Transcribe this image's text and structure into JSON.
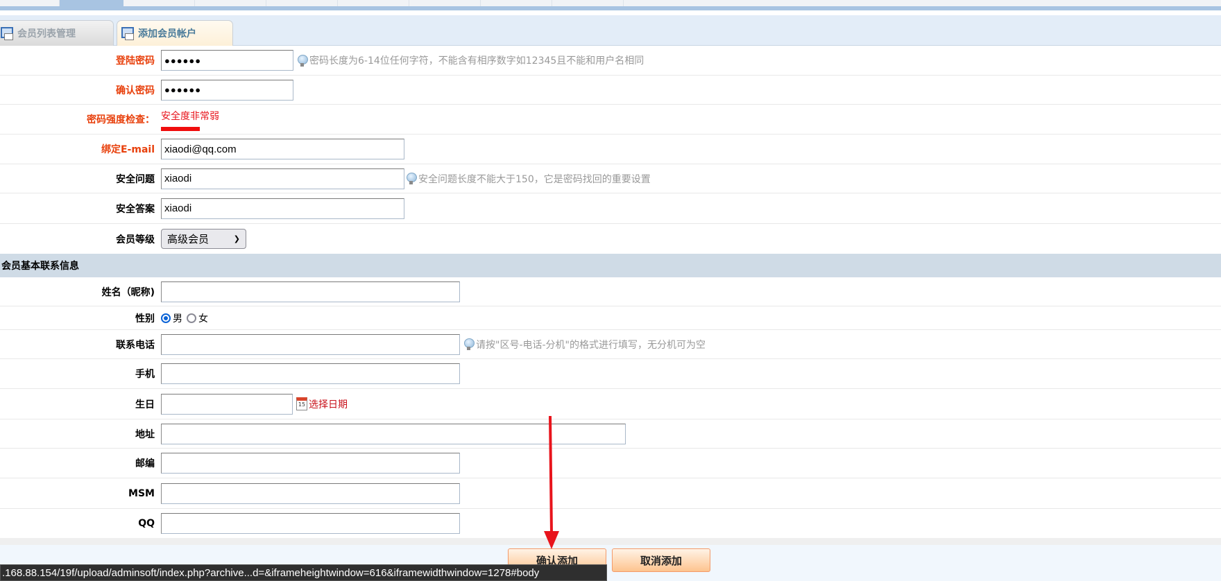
{
  "tabs": [
    {
      "label": "会员列表管理",
      "active": false
    },
    {
      "label": "添加会员帐户",
      "active": true
    }
  ],
  "form": {
    "password": {
      "label": "登陆密码",
      "value": "●●●●●●",
      "hint": "密码长度为6-14位任何字符，不能含有相序数字如12345且不能和用户名相同"
    },
    "confirm_password": {
      "label": "确认密码",
      "value": "●●●●●●"
    },
    "strength": {
      "label": "密码强度检查：",
      "value": "安全度非常弱",
      "level": 0.2
    },
    "email": {
      "label": "绑定E-mail",
      "value": "xiaodi@qq.com"
    },
    "question": {
      "label": "安全问题",
      "value": "xiaodi",
      "hint": "安全问题长度不能大于150，它是密码找回的重要设置"
    },
    "answer": {
      "label": "安全答案",
      "value": "xiaodi"
    },
    "level": {
      "label": "会员等级",
      "selected": "高级会员"
    }
  },
  "section_title": "会员基本联系信息",
  "contact": {
    "name": {
      "label": "姓名（昵称)",
      "value": ""
    },
    "gender": {
      "label": "性别",
      "options": [
        "男",
        "女"
      ],
      "selected": "男"
    },
    "phone": {
      "label": "联系电话",
      "value": "",
      "hint": "请按\"区号-电话-分机\"的格式进行填写，无分机可为空"
    },
    "mobile": {
      "label": "手机",
      "value": ""
    },
    "birthday": {
      "label": "生日",
      "value": "",
      "picker": "选择日期"
    },
    "address": {
      "label": "地址",
      "value": ""
    },
    "zip": {
      "label": "邮编",
      "value": ""
    },
    "msm": {
      "label": "MSM",
      "value": ""
    },
    "qq": {
      "label": "QQ",
      "value": ""
    }
  },
  "buttons": {
    "confirm": "确认添加",
    "cancel": "取消添加"
  },
  "status_url": ".168.88.154/19f/upload/adminsoft/index.php?archive...d=&iframeheightwindow=616&iframewidthwindow=1278#body",
  "colors": {
    "required_label": "#e8400c",
    "annotation": "#e8141c",
    "section_bg": "#cfdbe6"
  }
}
